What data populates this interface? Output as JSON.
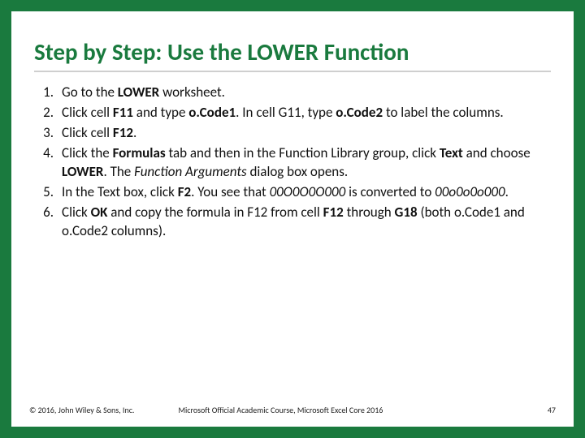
{
  "title": "Step by Step: Use the LOWER Function",
  "steps": {
    "s1": {
      "num": "1.",
      "a": "Go to the ",
      "b": "LOWER",
      "c": " worksheet."
    },
    "s2": {
      "num": "2.",
      "a": "Click cell ",
      "b": "F11",
      "c": " and type ",
      "d": "o.Code1",
      "e": ". In cell G11, type ",
      "f": "o.Code2",
      "g": " to label the columns."
    },
    "s3": {
      "num": "3.",
      "a": "Click cell ",
      "b": "F12",
      "c": "."
    },
    "s4": {
      "num": "4.",
      "a": "Click the ",
      "b": "Formulas ",
      "c": "tab and then in the Function Library group, click ",
      "d": "Text ",
      "e": "and choose ",
      "f": "LOWER",
      "g": ". The ",
      "h": "Function Arguments ",
      "i": "dialog box opens."
    },
    "s5": {
      "num": "5.",
      "a": "In the Text box, click ",
      "b": "F2",
      "c": ". You see that ",
      "d": "00O0O0O000 ",
      "e": "is converted to ",
      "f": "00o0o0o000",
      "g": "."
    },
    "s6": {
      "num": "6.",
      "a": "Click ",
      "b": "OK ",
      "c": "and copy the formula in F12 from cell ",
      "d": "F12 ",
      "e": "through ",
      "f": "G18 ",
      "g": "(both o.Code1 and o.Code2 columns)."
    }
  },
  "footer": {
    "copyright": "© 2016, John Wiley & Sons, Inc.",
    "course": "Microsoft Official Academic Course, Microsoft Excel Core 2016",
    "page": "47"
  }
}
